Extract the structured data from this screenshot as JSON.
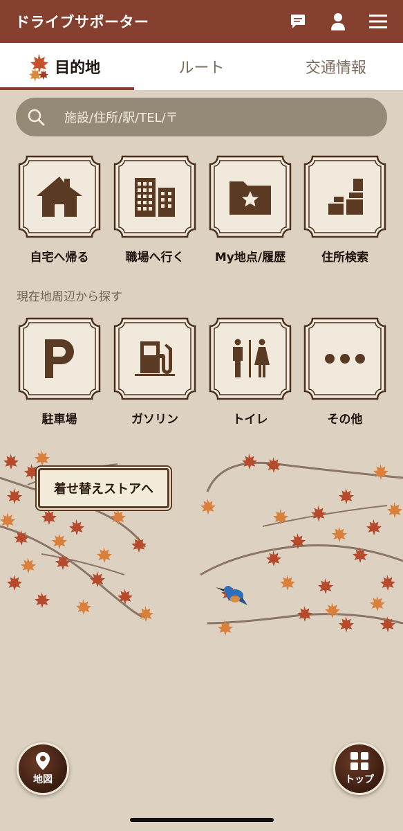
{
  "header": {
    "title": "ドライブサポーター",
    "icons": [
      "chat-icon",
      "user-icon",
      "menu-icon"
    ]
  },
  "tabs": [
    {
      "label": "目的地",
      "active": true
    },
    {
      "label": "ルート",
      "active": false
    },
    {
      "label": "交通情報",
      "active": false
    }
  ],
  "search": {
    "placeholder": "施設/住所/駅/TEL/〒"
  },
  "shortcuts": [
    {
      "label": "自宅へ帰る",
      "icon": "home-icon"
    },
    {
      "label": "職場へ行く",
      "icon": "office-building-icon"
    },
    {
      "label": "My地点/履歴",
      "icon": "folder-star-icon"
    },
    {
      "label": "住所検索",
      "icon": "address-map-icon"
    }
  ],
  "nearby": {
    "section_label": "現在地周辺から探す",
    "items": [
      {
        "label": "駐車場",
        "icon": "parking-icon"
      },
      {
        "label": "ガソリン",
        "icon": "gas-station-icon"
      },
      {
        "label": "トイレ",
        "icon": "restroom-icon"
      },
      {
        "label": "その他",
        "icon": "more-icon"
      }
    ]
  },
  "store_button": {
    "label": "着せ替えストアへ"
  },
  "fabs": {
    "map_label": "地図",
    "top_label": "トップ"
  },
  "colors": {
    "header_bg": "#86402f",
    "page_bg": "#ddd2c1",
    "tile_bg": "#f1e9db",
    "icon_brown": "#5a3a22"
  }
}
